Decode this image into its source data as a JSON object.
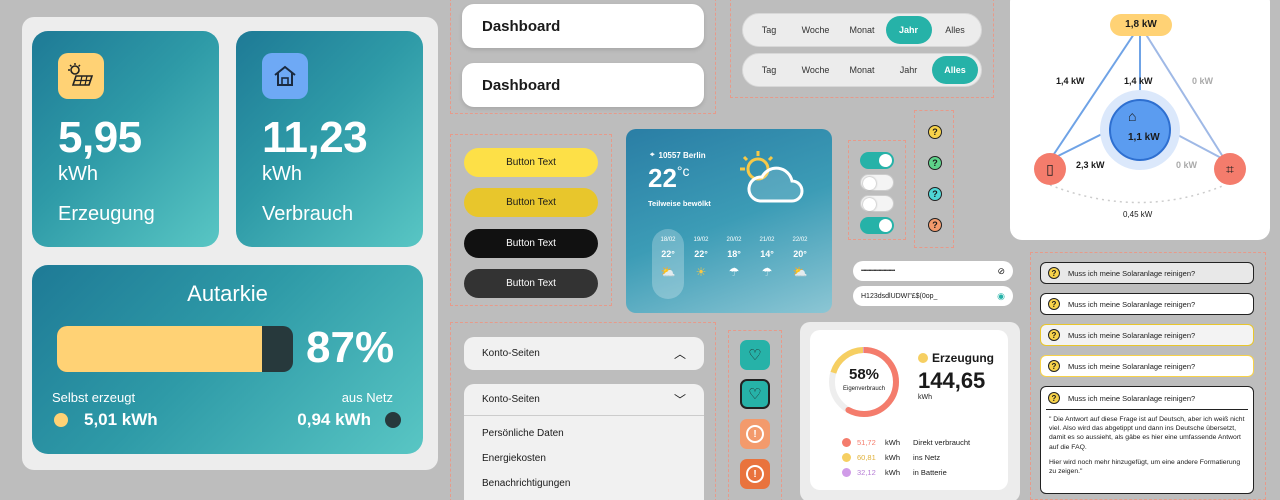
{
  "tiles": {
    "production": {
      "value": "5,95",
      "unit": "kWh",
      "label": "Erzeugung"
    },
    "consumption": {
      "value": "11,23",
      "unit": "kWh",
      "label": "Verbrauch"
    }
  },
  "autarky": {
    "title": "Autarkie",
    "percent_text": "87%",
    "percent": 0.87,
    "self_label": "Selbst erzeugt",
    "self_value": "5,01 kWh",
    "grid_label": "aus Netz",
    "grid_value": "0,94 kWh",
    "colors": {
      "self": "#ffd275",
      "grid": "#27393c"
    }
  },
  "nav": [
    {
      "label": "Dashboard"
    },
    {
      "label": "Dashboard"
    }
  ],
  "segmented": [
    {
      "options": [
        "Tag",
        "Woche",
        "Monat",
        "Jahr",
        "Alles"
      ],
      "active": "Jahr"
    },
    {
      "options": [
        "Tag",
        "Woche",
        "Monat",
        "Jahr",
        "Alles"
      ],
      "active": "Alles"
    }
  ],
  "buttons": [
    {
      "label": "Button Text",
      "bg": "#fde047",
      "fg": "#1a1a1a"
    },
    {
      "label": "Button Text",
      "bg": "#e8c62c",
      "fg": "#1a1a1a"
    },
    {
      "label": "Button Text",
      "bg": "#111111",
      "fg": "#ffffff"
    },
    {
      "label": "Button Text",
      "bg": "#333333",
      "fg": "#ffffff"
    }
  ],
  "weather": {
    "location": "10557 Berlin",
    "temp": "22",
    "temp_unit": "°c",
    "condition": "Teilweise bewölkt",
    "days": [
      {
        "date": "18/02",
        "temp": "22°",
        "icon": "partly-cloudy-icon"
      },
      {
        "date": "19/02",
        "temp": "22°",
        "icon": "sun-icon"
      },
      {
        "date": "20/02",
        "temp": "18°",
        "icon": "rain-icon"
      },
      {
        "date": "21/02",
        "temp": "14°",
        "icon": "rain-icon"
      },
      {
        "date": "22/02",
        "temp": "20°",
        "icon": "partly-cloudy-icon"
      }
    ]
  },
  "toggles": [
    {
      "on": true
    },
    {
      "on": false
    },
    {
      "on": false
    },
    {
      "on": true
    }
  ],
  "question_icons": [
    {
      "color": "#f7d24a"
    },
    {
      "color": "#5ed28a"
    },
    {
      "color": "#4fd6d6"
    },
    {
      "color": "#f39a6c"
    }
  ],
  "password_fields": [
    {
      "value": "•••••••••••••••••••••••••••",
      "icon": "eye-off-icon"
    },
    {
      "value": "H123dsdlUDWI\"£$(0op_",
      "icon": "eye-icon"
    }
  ],
  "flow": {
    "solar": "1,8 kW",
    "left_branch": "1,4 kW",
    "center_branch": "1,4 kW",
    "right_branch": "0 kW",
    "house": "1,1 kW",
    "battery_flow": "2,3 kW",
    "grid_flow": "0 kW",
    "bottom": "0,45 kW"
  },
  "faq": {
    "question": "Muss ich meine Solaranlage reinigen?",
    "answer1": "\" Die Antwort auf diese Frage ist auf Deutsch, aber ich weiß nicht viel. Also wird das abgetippt und dann ins Deutsche übersetzt, damit es so aussieht, als gäbe es hier eine umfassende Antwort auf die FAQ.",
    "answer2": "Hier wird noch mehr hinzugefügt, um eine andere Formatierung zu zeigen.\""
  },
  "accordion": {
    "title": "Konto-Seiten",
    "items": [
      "Persönliche Daten",
      "Energiekosten",
      "Benachrichtigungen"
    ]
  },
  "donut": {
    "percent_text": "58%",
    "percent_label": "Eigenverbrauch",
    "legend_title": "Erzeugung",
    "total": "144,65",
    "total_unit": "kWh",
    "rows": [
      {
        "value": "51,72",
        "unit": "kWh",
        "label": "Direkt verbraucht",
        "color": "#f47c6c"
      },
      {
        "value": "60,81",
        "unit": "kWh",
        "label": "ins Netz",
        "color": "#f6cf62"
      },
      {
        "value": "32,12",
        "unit": "kWh",
        "label": "in Batterie",
        "color": "#d09be8"
      }
    ]
  }
}
